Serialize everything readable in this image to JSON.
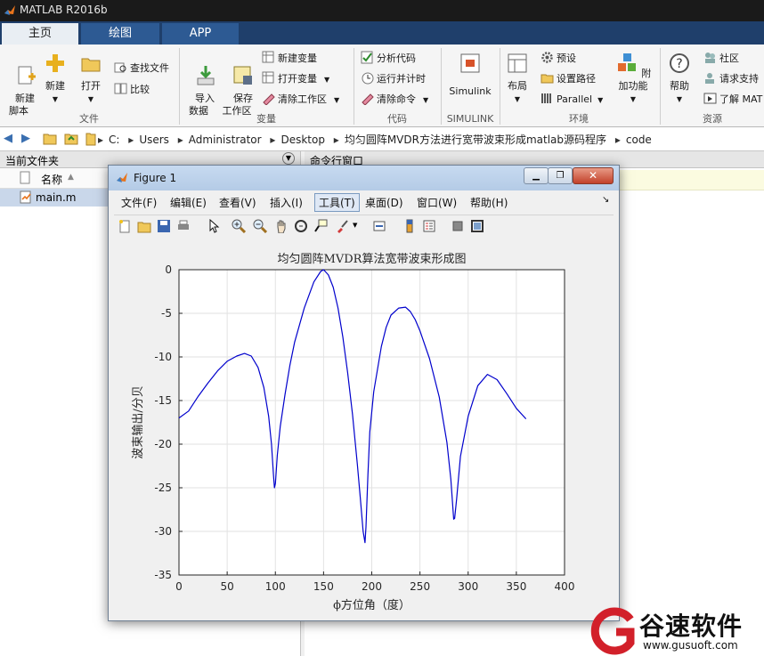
{
  "app": {
    "title": "MATLAB R2016b"
  },
  "tabs": [
    {
      "label": "主页"
    },
    {
      "label": "绘图"
    },
    {
      "label": "APP"
    }
  ],
  "ribbon": {
    "file_group": {
      "new_script": "新建\n脚本",
      "new": "新建",
      "open": "打开",
      "find_files": "查找文件",
      "compare": "比较",
      "label": "文件"
    },
    "variable_group": {
      "import_data": "导入\n数据",
      "save_workspace": "保存\n工作区",
      "new_variable": "新建变量",
      "open_variable": "打开变量",
      "clear_workspace": "清除工作区",
      "label": "变量"
    },
    "code_group": {
      "analyze_code": "分析代码",
      "run_and_time": "运行并计时",
      "clear_commands": "清除命令",
      "label": "代码"
    },
    "simulink_group": {
      "simulink": "Simulink",
      "label": "SIMULINK"
    },
    "environment_group": {
      "layout": "布局",
      "preferences": "预设",
      "set_path": "设置路径",
      "parallel": "Parallel",
      "addons": "附加功能",
      "label": "环境"
    },
    "resources_group": {
      "help": "帮助",
      "community": "社区",
      "request_support": "请求支持",
      "learn_matlab": "了解 MAT",
      "label": "资源"
    }
  },
  "address": {
    "crumbs": [
      "C:",
      "Users",
      "Administrator",
      "Desktop",
      "均匀圆阵MVDR方法进行宽带波束形成matlab源码程序",
      "code"
    ]
  },
  "current_folder": {
    "title": "当前文件夹",
    "column_name": "名称",
    "files": [
      {
        "name": "main.m"
      }
    ]
  },
  "command_window": {
    "title": "命令行窗口"
  },
  "figure": {
    "window_title": "Figure 1",
    "menu": [
      "文件(F)",
      "编辑(E)",
      "查看(V)",
      "插入(I)",
      "工具(T)",
      "桌面(D)",
      "窗口(W)",
      "帮助(H)"
    ],
    "active_menu": "工具(T)"
  },
  "watermark": {
    "brand": "谷速软件",
    "url": "www.gusuoft.com"
  },
  "colors": {
    "line": "#0000cc",
    "tabbar": "#1f3f6b",
    "grid": "#e2e2e2"
  },
  "chart_data": {
    "type": "line",
    "title": "均匀圆阵MVDR算法宽带波束形成图",
    "xlabel": "ϕ方位角（度）",
    "ylabel": "波束输出/分贝",
    "xlim": [
      0,
      400
    ],
    "ylim": [
      -35,
      0
    ],
    "xticks": [
      0,
      50,
      100,
      150,
      200,
      250,
      300,
      350,
      400
    ],
    "yticks": [
      0,
      -5,
      -10,
      -15,
      -20,
      -25,
      -30,
      -35
    ],
    "grid": true,
    "series": [
      {
        "x": [
          0,
          10,
          20,
          30,
          40,
          50,
          60,
          68,
          75,
          82,
          88,
          93,
          96,
          98,
          99,
          100,
          102,
          105,
          110,
          115,
          120,
          130,
          140,
          147,
          150,
          155,
          160,
          165,
          170,
          175,
          180,
          185,
          188,
          191,
          193,
          194,
          196,
          198,
          202,
          210,
          215,
          220,
          228,
          235,
          240,
          245,
          250,
          260,
          270,
          278,
          282,
          285,
          286,
          288,
          292,
          300,
          310,
          320,
          330,
          340,
          350,
          360
        ],
        "y": [
          -17,
          -16.2,
          -14.5,
          -13,
          -11.6,
          -10.5,
          -9.9,
          -9.6,
          -9.9,
          -11.2,
          -13.5,
          -16.8,
          -20,
          -23.5,
          -25,
          -24.5,
          -21.3,
          -18,
          -14.3,
          -11,
          -8.3,
          -4.4,
          -1.4,
          -0.2,
          0,
          -0.6,
          -2,
          -4.4,
          -7.7,
          -11.8,
          -16.6,
          -22.3,
          -26,
          -30,
          -31.3,
          -29.5,
          -23.5,
          -18.6,
          -14,
          -8.8,
          -6.6,
          -5.2,
          -4.4,
          -4.3,
          -4.8,
          -5.7,
          -7,
          -10.2,
          -14.6,
          -19.8,
          -24,
          -28.6,
          -28.5,
          -26.3,
          -21.4,
          -16.8,
          -13.3,
          -12,
          -12.6,
          -14.2,
          -15.9,
          -17.1
        ]
      }
    ]
  }
}
